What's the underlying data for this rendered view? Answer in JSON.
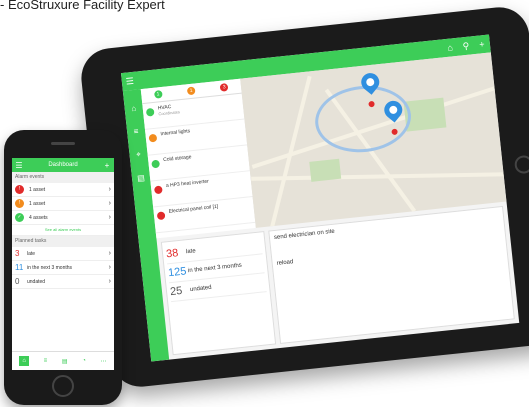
{
  "caption": "- EcoStruxure Facility Expert",
  "tablet": {
    "tabs": [
      "1",
      "1",
      "3"
    ],
    "items": [
      {
        "title": "HVAC",
        "sub": "Coordinates",
        "color": "g"
      },
      {
        "title": "Internal lights",
        "sub": "",
        "color": "o"
      },
      {
        "title": "Cold storage",
        "sub": "",
        "color": "g"
      },
      {
        "title": "a HP3 heat inverter",
        "sub": "",
        "color": "r"
      },
      {
        "title": "Electrical panel coil [1]",
        "sub": "",
        "color": "r"
      }
    ],
    "stats": [
      {
        "n": "38",
        "label": "late",
        "color": "#e12b2b"
      },
      {
        "n": "125",
        "label": "in the next 3 months",
        "color": "#2f8fe0"
      },
      {
        "n": "25",
        "label": "undated",
        "color": "#555"
      }
    ],
    "task_title": "send electrician on site",
    "task2_title": "reload"
  },
  "phone": {
    "title": "Dashboard",
    "section1": "Alarm events",
    "rows": [
      {
        "label": "1 asset",
        "icon": "!",
        "color": "r"
      },
      {
        "label": "1 asset",
        "icon": "!",
        "color": "o"
      },
      {
        "label": "4 assets",
        "icon": "✓",
        "color": "g"
      }
    ],
    "link": "See all alarm events",
    "section2": "Planned tasks",
    "stats": [
      {
        "n": "3",
        "label": "late",
        "color": "#e12b2b"
      },
      {
        "n": "11",
        "label": "in the next 3 months",
        "color": "#2f8fe0"
      },
      {
        "n": "0",
        "label": "undated",
        "color": "#555"
      }
    ]
  }
}
